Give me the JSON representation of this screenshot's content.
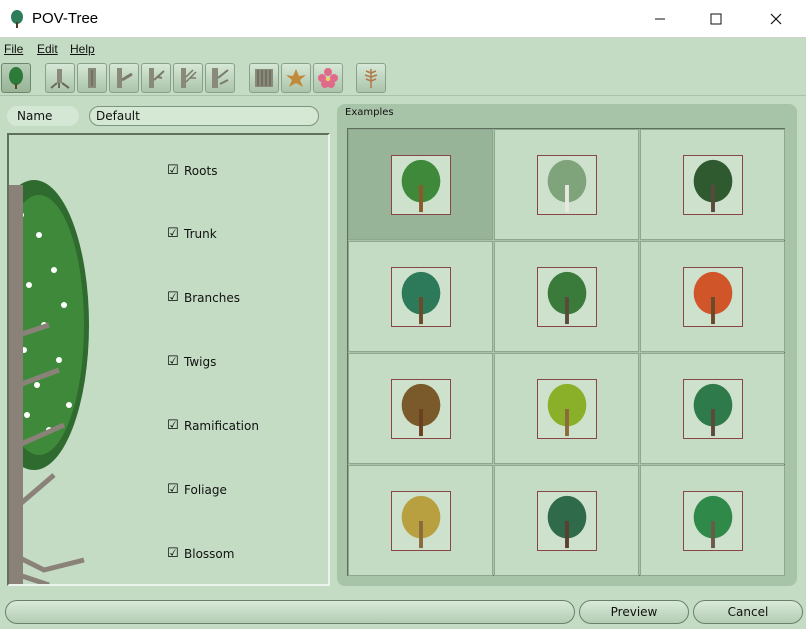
{
  "window": {
    "title": "POV-Tree",
    "app_icon": "tree-icon",
    "controls": [
      "minimize-icon",
      "maximize-icon",
      "close-icon"
    ]
  },
  "menu": {
    "items": [
      {
        "label": "File"
      },
      {
        "label": "Edit"
      },
      {
        "label": "Help"
      }
    ]
  },
  "toolbar": {
    "buttons": [
      "tree-icon",
      "roots-icon",
      "trunk-icon",
      "branches-icon",
      "twigs-icon",
      "ramification-icon",
      "texture-icon",
      "leaf-icon",
      "blossom-icon",
      "fern-icon"
    ]
  },
  "name_field": {
    "label": "Name",
    "value": "Default"
  },
  "options": {
    "check_glyph": "☑",
    "items": [
      {
        "label": "Roots",
        "checked": true
      },
      {
        "label": "Trunk",
        "checked": true
      },
      {
        "label": "Branches",
        "checked": true
      },
      {
        "label": "Twigs",
        "checked": true
      },
      {
        "label": "Ramification",
        "checked": true
      },
      {
        "label": "Foliage",
        "checked": true
      },
      {
        "label": "Blossom",
        "checked": true
      }
    ]
  },
  "examples": {
    "title": "Examples",
    "selected_index": 0,
    "items": [
      {
        "icon": "sparse-tree-icon",
        "foliage": "#3f8a3a",
        "trunk": "#8a5a2a"
      },
      {
        "icon": "birch-tree-icon",
        "foliage": "#7fa37a",
        "trunk": "#e8e8e0"
      },
      {
        "icon": "blossom-tree-icon",
        "foliage": "#2f5a2f",
        "trunk": "#5a4a3a"
      },
      {
        "icon": "fir-tree-icon",
        "foliage": "#2d7a5a",
        "trunk": "#6a4a2a"
      },
      {
        "icon": "oak-tree-icon",
        "foliage": "#3a7a3a",
        "trunk": "#5a4a3a"
      },
      {
        "icon": "autumn-tree-icon",
        "foliage": "#d0562a",
        "trunk": "#6a4a2a"
      },
      {
        "icon": "bare-tree-icon",
        "foliage": "#7a5a2a",
        "trunk": "#6a4020"
      },
      {
        "icon": "palm-tree-icon",
        "foliage": "#8ab02a",
        "trunk": "#8a6a3a"
      },
      {
        "icon": "round-tree-icon",
        "foliage": "#2f7a4a",
        "trunk": "#5a4a3a"
      },
      {
        "icon": "cypress-tree-icon",
        "foliage": "#b8a040",
        "trunk": "#8a6a3a"
      },
      {
        "icon": "conifer-tree-icon",
        "foliage": "#2f6a4a",
        "trunk": "#5a4030"
      },
      {
        "icon": "bushy-tree-icon",
        "foliage": "#2f8a4a",
        "trunk": "#6a5a4a"
      }
    ]
  },
  "buttons": {
    "preview": "Preview",
    "cancel": "Cancel"
  },
  "colors": {
    "background": "#c4dcc4",
    "selected_cell": "#98b498",
    "thumb_border": "#8a4545"
  }
}
